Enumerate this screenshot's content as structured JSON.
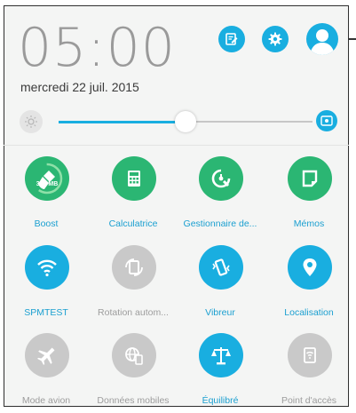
{
  "header": {
    "time": "05:00",
    "date": "mercredi 22 juil. 2015",
    "icons": [
      "edit-icon",
      "settings-icon",
      "user-icon"
    ]
  },
  "brightness": {
    "level_percent": 50
  },
  "tiles": [
    {
      "label": "Boost",
      "icon": "broom-icon",
      "state": "on",
      "badge": "314 MB",
      "color": "#2bb673"
    },
    {
      "label": "Calculatrice",
      "icon": "calculator-icon",
      "state": "on",
      "color": "#2bb673"
    },
    {
      "label": "Gestionnaire de...",
      "icon": "task-manager-icon",
      "state": "on",
      "color": "#2bb673"
    },
    {
      "label": "Mémos",
      "icon": "memo-icon",
      "state": "on",
      "color": "#2bb673"
    },
    {
      "label": "SPMTEST",
      "icon": "wifi-icon",
      "state": "on",
      "color": "#19aee0"
    },
    {
      "label": "Rotation autom...",
      "icon": "rotation-icon",
      "state": "off",
      "color": "#c9c9c9"
    },
    {
      "label": "Vibreur",
      "icon": "vibrate-icon",
      "state": "on",
      "color": "#19aee0"
    },
    {
      "label": "Localisation",
      "icon": "location-icon",
      "state": "on",
      "color": "#19aee0"
    },
    {
      "label": "Mode avion",
      "icon": "airplane-icon",
      "state": "off",
      "color": "#c9c9c9"
    },
    {
      "label": "Données mobiles",
      "icon": "mobile-data-icon",
      "state": "off",
      "color": "#c9c9c9"
    },
    {
      "label": "Équilibré",
      "icon": "balance-icon",
      "state": "on",
      "color": "#19aee0"
    },
    {
      "label": "Point d'accès",
      "icon": "hotspot-icon",
      "state": "off",
      "color": "#c9c9c9"
    }
  ],
  "colors": {
    "accent": "#19aee0",
    "green": "#2bb673",
    "disabled": "#c9c9c9"
  }
}
